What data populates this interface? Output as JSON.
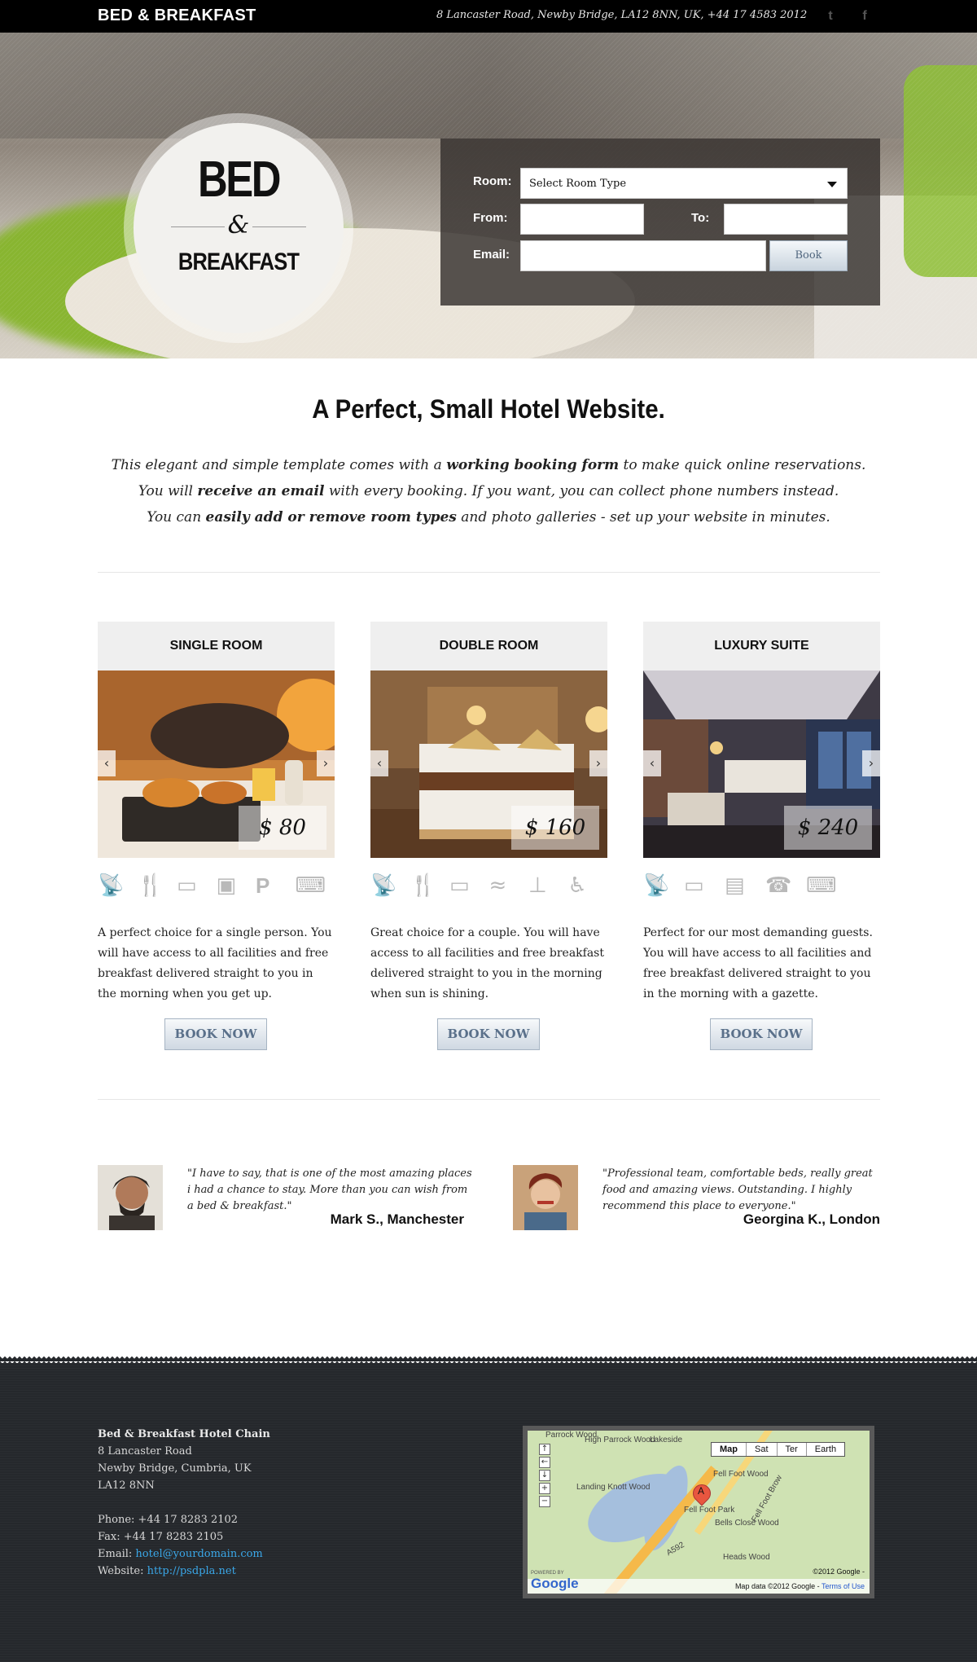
{
  "topbar": {
    "brand": "BED & BREAKFAST",
    "address": "8 Lancaster Road, Newby Bridge, LA12 8NN, UK, +44 17 4583 2012",
    "twitter_icon": "t",
    "facebook_icon": "f"
  },
  "hero": {
    "logo": {
      "line1": "BED",
      "ampersand": "&",
      "line2": "BREAKFAST"
    },
    "booking": {
      "room_label": "Room:",
      "room_value": "Select Room Type",
      "from_label": "From:",
      "to_label": "To:",
      "email_label": "Email:",
      "book_label": "Book"
    }
  },
  "intro": {
    "title": "A Perfect, Small Hotel Website.",
    "line1": {
      "a": "This elegant and simple template comes with a ",
      "b": "working booking form",
      "c": " to make quick online reservations."
    },
    "line2": {
      "a": "You will ",
      "b": "receive an email",
      "c": " with every booking. If you want, you can collect phone numbers instead."
    },
    "line3": {
      "a": "You can ",
      "b": "easily add or remove room types",
      "c": " and photo galleries - set up your website in minutes."
    }
  },
  "rooms": [
    {
      "title": "SINGLE ROOM",
      "price": "$ 80",
      "icons": [
        "satellite-icon",
        "dining-icon",
        "tv-icon",
        "laundry-icon",
        "parking-icon",
        "wifi-laptop-icon"
      ],
      "description": "A perfect choice for a single person. You will have access to all facilities and free breakfast delivered straight to you in the morning when you get up.",
      "book_label": "BOOK NOW"
    },
    {
      "title": "DOUBLE ROOM",
      "price": "$ 160",
      "icons": [
        "satellite-icon",
        "dining-icon",
        "tv-icon",
        "swimming-icon",
        "gym-icon",
        "accessible-icon"
      ],
      "description": "Great choice for a couple. You will have access to all facilities and free breakfast delivered straight to you in the morning when sun is shining.",
      "book_label": "BOOK NOW"
    },
    {
      "title": "LUXURY SUITE",
      "price": "$ 240",
      "icons": [
        "satellite-icon",
        "tv-icon",
        "newspaper-icon",
        "phone-icon",
        "wifi-laptop-icon"
      ],
      "description": "Perfect for our most demanding guests. You will have access to all facilities and free breakfast delivered straight to you in the morning with a gazette.",
      "book_label": "BOOK NOW"
    }
  ],
  "testimonials": [
    {
      "quote": "\"I have to say, that is one of the most amazing places i had a chance to stay. More than you can wish from a bed & breakfast.\"",
      "author": "Mark S., Manchester"
    },
    {
      "quote": "\"Professional team, comfortable beds, really great food and amazing views. Outstanding. I highly recommend this place to everyone.\"",
      "author": "Georgina K., London"
    }
  ],
  "footer": {
    "name": "Bed & Breakfast Hotel Chain",
    "address1": "8 Lancaster Road",
    "address2": "Newby Bridge, Cumbria, UK",
    "address3": "LA12 8NN",
    "phone": "Phone: +44 17 8283 2102",
    "fax": "Fax: +44 17 8283 2105",
    "email_label": "Email: ",
    "email": "hotel@yourdomain.com",
    "website_label": "Website: ",
    "website": "http://psdpla.net",
    "map": {
      "tabs": [
        "Map",
        "Sat",
        "Ter",
        "Earth"
      ],
      "marker": "A",
      "places": [
        "Parrock Wood",
        "High Parrock Wood",
        "Lakeside",
        "Landing Knott Wood",
        "Fell Foot Wood",
        "Fell Foot Brow",
        "Bells Close Wood",
        "Heads Wood",
        "A592",
        "Fell Foot Park"
      ],
      "copyright": "©2012 Google -",
      "data_credit": "Map data ©2012 Google - ",
      "terms": "Terms of Use",
      "powered": "POWERED BY",
      "google": "Google"
    }
  }
}
